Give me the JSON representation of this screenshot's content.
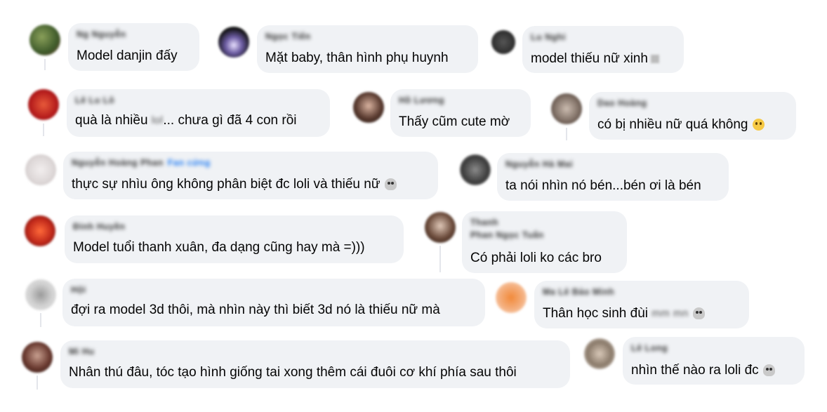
{
  "comments": [
    {
      "id": "c1",
      "author": "Ng Nguyễn",
      "text": "Model danjin đấy"
    },
    {
      "id": "c2",
      "author": "Ngọc Tiến",
      "text": "Mặt baby, thân hình phụ huynh"
    },
    {
      "id": "c3",
      "author": "Lu Nghi",
      "text": "model thiếu nữ xinh"
    },
    {
      "id": "c4",
      "author": "Lê Lu Lô",
      "text_a": "quà là nhiều ",
      "blur": "lol",
      "text_b": "... chưa gì đã 4 con rồi"
    },
    {
      "id": "c5",
      "author": "Hồ Lương",
      "text": "Thấy cũm cute mờ"
    },
    {
      "id": "c6",
      "author": "Dao Hoàng",
      "text": "có bị nhiều nữ quá không"
    },
    {
      "id": "c7",
      "author": "Nguyễn Hoàng Phan",
      "badge": "Fan cứng",
      "text": "thực sự nhìu ông không phân biệt đc loli và thiếu nữ"
    },
    {
      "id": "c8",
      "author": "Nguyễn Hà Mai",
      "text": "ta nói nhìn nó bén...bén ơi là bén"
    },
    {
      "id": "c9",
      "author": "Đinh Huyền",
      "text": "Model tuổi thanh xuân, đa dạng cũng hay mà =)))"
    },
    {
      "id": "c10",
      "author": "Thanh",
      "author2": "Phan Ngọc Tuấn",
      "text": "Có phải loli ko các bro"
    },
    {
      "id": "c11",
      "author": "Hội",
      "text": "đợi ra model 3d thôi, mà nhìn này thì biết 3d nó là thiếu nữ mà"
    },
    {
      "id": "c12",
      "author": "Ma Lê Bảo Minh",
      "text_a": "Thân học sinh đùi ",
      "blur": "mm mn"
    },
    {
      "id": "c13",
      "author": "Mi Hu",
      "text": "Nhân thú đâu, tóc tạo hình giống tai xong thêm cái đuôi cơ khí phía sau thôi"
    },
    {
      "id": "c14",
      "author": "Lê Long",
      "text": "nhìn thế nào ra loli đc"
    }
  ]
}
